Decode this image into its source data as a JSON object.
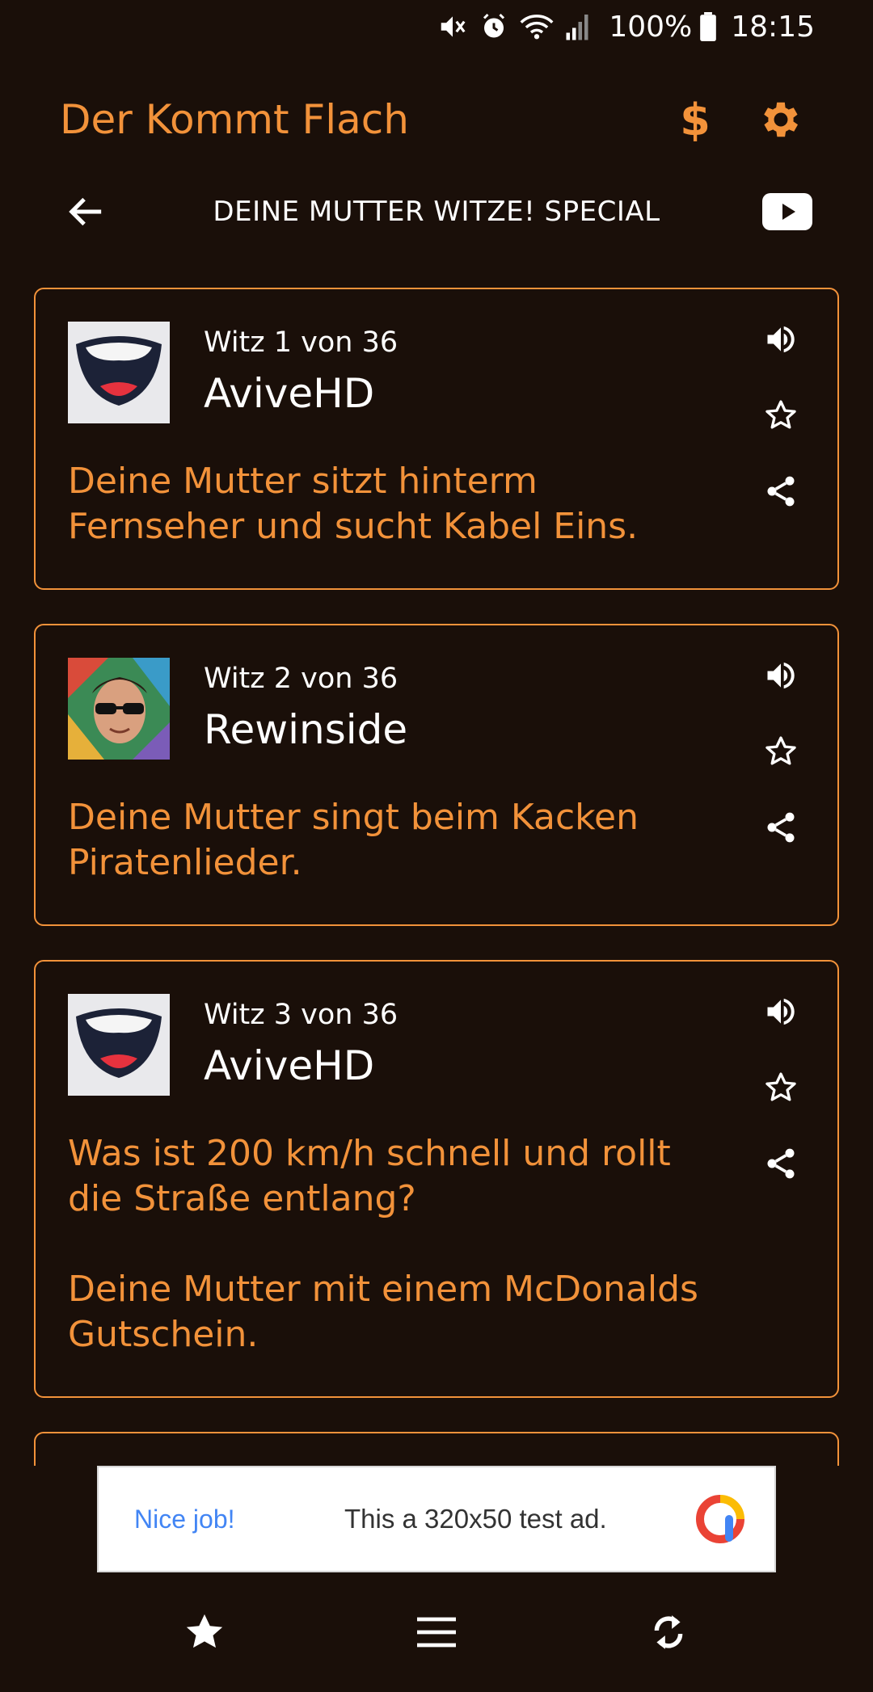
{
  "status_bar": {
    "battery": "100%",
    "time": "18:15",
    "icons": [
      "mute-icon",
      "alarm-icon",
      "wifi-icon",
      "signal-icon",
      "battery-icon"
    ]
  },
  "app_bar": {
    "title": "Der Kommt Flach",
    "donate_symbol": "$",
    "icons": [
      "dollar-icon",
      "settings-gear-icon"
    ]
  },
  "sub_header": {
    "title": "DEINE MUTTER WITZE! SPECIAL",
    "icons": [
      "back-arrow-icon",
      "youtube-icon"
    ]
  },
  "jokes": [
    {
      "counter": "Witz 1 von 36",
      "author": "AviveHD",
      "text": "Deine Mutter sitzt hinterm Fernseher und sucht Kabel Eins.",
      "avatar": "mouth-logo-avatar"
    },
    {
      "counter": "Witz 2 von 36",
      "author": "Rewinside",
      "text": "Deine Mutter singt beim Kacken Piratenlieder.",
      "avatar": "sunglasses-man-avatar"
    },
    {
      "counter": "Witz 3 von 36",
      "author": "AviveHD",
      "text": "Was ist 200 km/h schnell und rollt die Straße entlang?\n\nDeine Mutter mit einem McDonalds Gutschein.",
      "avatar": "mouth-logo-avatar"
    }
  ],
  "card_actions": [
    "speaker-icon",
    "star-outline-icon",
    "share-icon"
  ],
  "ad": {
    "label_left": "Nice job!",
    "text": "This a 320x50 test ad."
  },
  "bottom_nav": [
    "favorites-star-icon",
    "menu-lines-icon",
    "refresh-icon"
  ],
  "colors": {
    "background": "#1a0f09",
    "accent": "#f2923a",
    "text": "#ffffff"
  }
}
